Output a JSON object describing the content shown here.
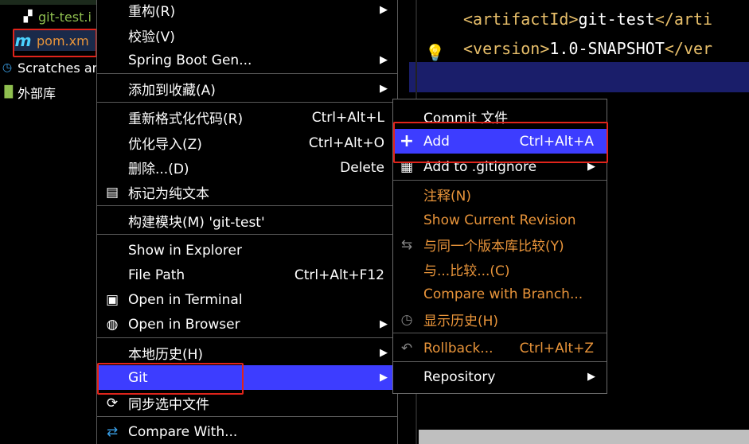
{
  "project_tree": {
    "items": [
      {
        "label": "git-test.i",
        "icon": "java-file-icon"
      },
      {
        "label": "pom.xm",
        "icon": "maven-icon"
      },
      {
        "label": "Scratches an",
        "icon": "scratches-icon"
      },
      {
        "label": "外部库",
        "icon": "library-icon"
      }
    ]
  },
  "editor": {
    "lines": [
      {
        "open": "<artifactId>",
        "text": "git-test",
        "close": "</arti"
      },
      {
        "open": "<version>",
        "text": "1.0-SNAPSHOT",
        "close": "</ver"
      }
    ]
  },
  "main_menu": {
    "items": [
      {
        "label": "重构(R)",
        "shortcut": "",
        "submenu": true
      },
      {
        "label": "校验(V)",
        "shortcut": "",
        "submenu": false
      },
      {
        "label": "Spring Boot Gen...",
        "shortcut": "",
        "submenu": true
      },
      {
        "label": "添加到收藏(A)",
        "shortcut": "",
        "submenu": true
      },
      {
        "label": "重新格式化代码(R)",
        "shortcut": "Ctrl+Alt+L",
        "submenu": false
      },
      {
        "label": "优化导入(Z)",
        "shortcut": "Ctrl+Alt+O",
        "submenu": false
      },
      {
        "label": "删除...(D)",
        "shortcut": "Delete",
        "submenu": false
      },
      {
        "label": "标记为纯文本",
        "shortcut": "",
        "submenu": false
      },
      {
        "label": "构建模块(M) 'git-test'",
        "shortcut": "",
        "submenu": false
      },
      {
        "label": "Show in Explorer",
        "shortcut": "",
        "submenu": false
      },
      {
        "label": "File Path",
        "shortcut": "Ctrl+Alt+F12",
        "submenu": false
      },
      {
        "label": "Open in Terminal",
        "shortcut": "",
        "submenu": false
      },
      {
        "label": "Open in Browser",
        "shortcut": "",
        "submenu": true
      },
      {
        "label": "本地历史(H)",
        "shortcut": "",
        "submenu": true
      },
      {
        "label": "Git",
        "shortcut": "",
        "submenu": true
      },
      {
        "label": "同步选中文件",
        "shortcut": "",
        "submenu": false
      },
      {
        "label": "Compare With...",
        "shortcut": "",
        "submenu": false
      }
    ]
  },
  "git_submenu": {
    "items": [
      {
        "label": "Commit 文件",
        "shortcut": ""
      },
      {
        "label": "Add",
        "shortcut": "Ctrl+Alt+A"
      },
      {
        "label": "Add to .gitignore",
        "shortcut": ""
      },
      {
        "label": "注释(N)",
        "shortcut": ""
      },
      {
        "label": "Show Current Revision",
        "shortcut": ""
      },
      {
        "label": "与同一个版本库比较(Y)",
        "shortcut": ""
      },
      {
        "label": "与...比较...(C)",
        "shortcut": ""
      },
      {
        "label": "Compare with Branch...",
        "shortcut": ""
      },
      {
        "label": "显示历史(H)",
        "shortcut": ""
      },
      {
        "label": "Rollback...",
        "shortcut": "Ctrl+Alt+Z"
      },
      {
        "label": "Repository",
        "shortcut": ""
      }
    ]
  },
  "colors": {
    "selection": "#3d3dff",
    "highlight_box": "#e0241b",
    "vcs_orange": "#e8943a",
    "tag": "#e8bf6a"
  }
}
